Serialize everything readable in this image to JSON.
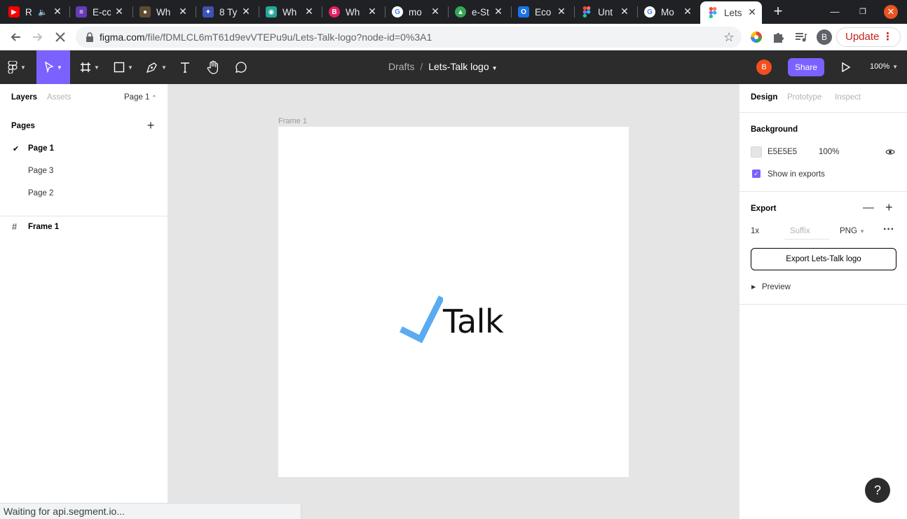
{
  "browser": {
    "tabs": [
      {
        "title": "R",
        "icon": "youtube-icon",
        "color": "#ff0000"
      },
      {
        "title": "E-co",
        "icon": "forms-icon",
        "color": "#673ab7"
      },
      {
        "title": "Wh",
        "icon": "monkey-icon",
        "color": "#5f4b32"
      },
      {
        "title": "8 Ty",
        "icon": "figure-icon",
        "color": "#3f51b5"
      },
      {
        "title": "Wh",
        "icon": "eye-icon",
        "color": "#26a69a"
      },
      {
        "title": "Wh",
        "icon": "b-logo-icon",
        "color": "#e91e63"
      },
      {
        "title": "mo",
        "icon": "google-icon",
        "color": "#4285f4"
      },
      {
        "title": "e-St",
        "icon": "triangle-logo-icon",
        "color": "#34a853"
      },
      {
        "title": "Eco",
        "icon": "outlook-icon",
        "color": "#1a73e8"
      },
      {
        "title": "Unt",
        "icon": "figma-icon",
        "color": "#f24e1e"
      },
      {
        "title": "Mo",
        "icon": "google-icon",
        "color": "#4285f4"
      },
      {
        "title": "Lets",
        "icon": "figma-icon",
        "color": "#f24e1e",
        "active": true
      }
    ],
    "url_host": "figma.com",
    "url_path": "/file/fDMLCL6mT61d9evVTEPu9u/Lets-Talk-logo?node-id=0%3A1",
    "profile_initial": "B",
    "update_label": "Update",
    "status_text": "Waiting for api.segment.io..."
  },
  "figma": {
    "breadcrumb_folder": "Drafts",
    "breadcrumb_sep": "/",
    "file_name": "Lets-Talk logo",
    "user_initial": "B",
    "share_label": "Share",
    "zoom_level": "100%",
    "accent_color": "#7b61ff",
    "left_panel": {
      "tab_layers": "Layers",
      "tab_assets": "Assets",
      "current_page": "Page 1",
      "pages_heading": "Pages",
      "pages": [
        "Page 1",
        "Page 3",
        "Page 2"
      ],
      "layers": [
        "Frame 1"
      ]
    },
    "canvas": {
      "frame_label": "Frame 1",
      "logo_text": "Talk",
      "logo_check_color": "#5aabf0"
    },
    "right_panel": {
      "tab_design": "Design",
      "tab_prototype": "Prototype",
      "tab_inspect": "Inspect",
      "background_heading": "Background",
      "bg_color_hex": "E5E5E5",
      "bg_opacity": "100%",
      "show_in_exports": "Show in exports",
      "export_heading": "Export",
      "export_scale": "1x",
      "export_suffix_placeholder": "Suffix",
      "export_format": "PNG",
      "export_button": "Export Lets-Talk logo",
      "preview_label": "Preview"
    },
    "help_label": "?"
  }
}
